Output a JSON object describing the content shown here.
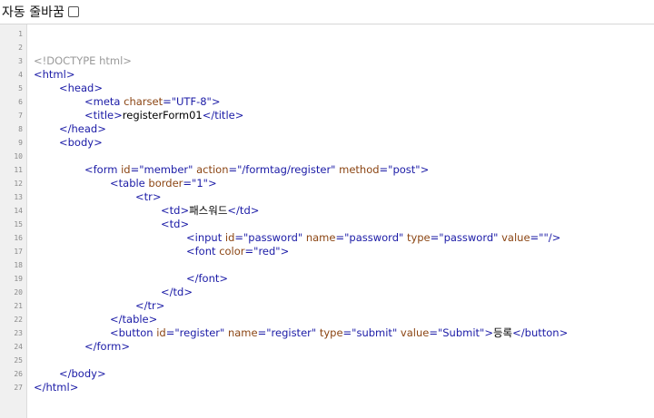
{
  "toolbar": {
    "wrap_label": "자동 줄바꿈",
    "wrap_checked": false
  },
  "editor": {
    "lines": [
      {
        "n": "1",
        "indent": 0,
        "tokens": []
      },
      {
        "n": "2",
        "indent": 0,
        "tokens": []
      },
      {
        "n": "3",
        "indent": 0,
        "tokens": [
          {
            "t": "<!DOCTYPE html>",
            "c": "doctype"
          }
        ]
      },
      {
        "n": "4",
        "indent": 0,
        "tokens": [
          {
            "t": "<html>",
            "c": "tag"
          }
        ]
      },
      {
        "n": "5",
        "indent": 1,
        "tokens": [
          {
            "t": "<head>",
            "c": "tag"
          }
        ]
      },
      {
        "n": "6",
        "indent": 2,
        "tokens": [
          {
            "t": "<meta ",
            "c": "tag"
          },
          {
            "t": "charset",
            "c": "attr"
          },
          {
            "t": "=\"UTF-8\"",
            "c": "val"
          },
          {
            "t": ">",
            "c": "tag"
          }
        ]
      },
      {
        "n": "7",
        "indent": 2,
        "tokens": [
          {
            "t": "<title>",
            "c": "tag"
          },
          {
            "t": "registerForm01",
            "c": "text"
          },
          {
            "t": "</title>",
            "c": "tag"
          }
        ]
      },
      {
        "n": "8",
        "indent": 1,
        "tokens": [
          {
            "t": "</head>",
            "c": "tag"
          }
        ]
      },
      {
        "n": "9",
        "indent": 1,
        "tokens": [
          {
            "t": "<body>",
            "c": "tag"
          }
        ]
      },
      {
        "n": "10",
        "indent": 0,
        "tokens": []
      },
      {
        "n": "11",
        "indent": 2,
        "tokens": [
          {
            "t": "<form ",
            "c": "tag"
          },
          {
            "t": "id",
            "c": "attr"
          },
          {
            "t": "=\"member\" ",
            "c": "val"
          },
          {
            "t": "action",
            "c": "attr"
          },
          {
            "t": "=\"/formtag/register\" ",
            "c": "val"
          },
          {
            "t": "method",
            "c": "attr"
          },
          {
            "t": "=\"post\"",
            "c": "val"
          },
          {
            "t": ">",
            "c": "tag"
          }
        ]
      },
      {
        "n": "12",
        "indent": 3,
        "tokens": [
          {
            "t": "<table ",
            "c": "tag"
          },
          {
            "t": "border",
            "c": "attr"
          },
          {
            "t": "=\"1\"",
            "c": "val"
          },
          {
            "t": ">",
            "c": "tag"
          }
        ]
      },
      {
        "n": "13",
        "indent": 4,
        "tokens": [
          {
            "t": "<tr>",
            "c": "tag"
          }
        ]
      },
      {
        "n": "14",
        "indent": 5,
        "tokens": [
          {
            "t": "<td>",
            "c": "tag"
          },
          {
            "t": "패스워드",
            "c": "text"
          },
          {
            "t": "</td>",
            "c": "tag"
          }
        ]
      },
      {
        "n": "15",
        "indent": 5,
        "tokens": [
          {
            "t": "<td>",
            "c": "tag"
          }
        ]
      },
      {
        "n": "16",
        "indent": 6,
        "tokens": [
          {
            "t": "<input ",
            "c": "tag"
          },
          {
            "t": "id",
            "c": "attr"
          },
          {
            "t": "=\"password\" ",
            "c": "val"
          },
          {
            "t": "name",
            "c": "attr"
          },
          {
            "t": "=\"password\" ",
            "c": "val"
          },
          {
            "t": "type",
            "c": "attr"
          },
          {
            "t": "=\"password\" ",
            "c": "val"
          },
          {
            "t": "value",
            "c": "attr"
          },
          {
            "t": "=\"\"",
            "c": "val"
          },
          {
            "t": "/>",
            "c": "tag"
          }
        ]
      },
      {
        "n": "17",
        "indent": 6,
        "tokens": [
          {
            "t": "<font ",
            "c": "tag"
          },
          {
            "t": "color",
            "c": "attr"
          },
          {
            "t": "=\"red\"",
            "c": "val"
          },
          {
            "t": ">",
            "c": "tag"
          }
        ]
      },
      {
        "n": "18",
        "indent": 0,
        "tokens": []
      },
      {
        "n": "19",
        "indent": 6,
        "tokens": [
          {
            "t": "</font>",
            "c": "tag"
          }
        ]
      },
      {
        "n": "20",
        "indent": 5,
        "tokens": [
          {
            "t": "</td>",
            "c": "tag"
          }
        ]
      },
      {
        "n": "21",
        "indent": 4,
        "tokens": [
          {
            "t": "</tr>",
            "c": "tag"
          }
        ]
      },
      {
        "n": "22",
        "indent": 3,
        "tokens": [
          {
            "t": "</table>",
            "c": "tag"
          }
        ]
      },
      {
        "n": "23",
        "indent": 3,
        "tokens": [
          {
            "t": "<button ",
            "c": "tag"
          },
          {
            "t": "id",
            "c": "attr"
          },
          {
            "t": "=\"register\" ",
            "c": "val"
          },
          {
            "t": "name",
            "c": "attr"
          },
          {
            "t": "=\"register\" ",
            "c": "val"
          },
          {
            "t": "type",
            "c": "attr"
          },
          {
            "t": "=\"submit\" ",
            "c": "val"
          },
          {
            "t": "value",
            "c": "attr"
          },
          {
            "t": "=\"Submit\"",
            "c": "val"
          },
          {
            "t": ">",
            "c": "tag"
          },
          {
            "t": "등록",
            "c": "text"
          },
          {
            "t": "</button>",
            "c": "tag"
          }
        ]
      },
      {
        "n": "24",
        "indent": 2,
        "tokens": [
          {
            "t": "</form>",
            "c": "tag"
          }
        ]
      },
      {
        "n": "25",
        "indent": 0,
        "tokens": []
      },
      {
        "n": "26",
        "indent": 1,
        "tokens": [
          {
            "t": "</body>",
            "c": "tag"
          }
        ]
      },
      {
        "n": "27",
        "indent": 0,
        "tokens": [
          {
            "t": "</html>",
            "c": "tag"
          }
        ]
      }
    ]
  },
  "colors": {
    "tag": "#1a1aa6",
    "attr": "#8b4513",
    "doctype": "#9a9a9a",
    "gutter_bg": "#f0f0f0"
  }
}
